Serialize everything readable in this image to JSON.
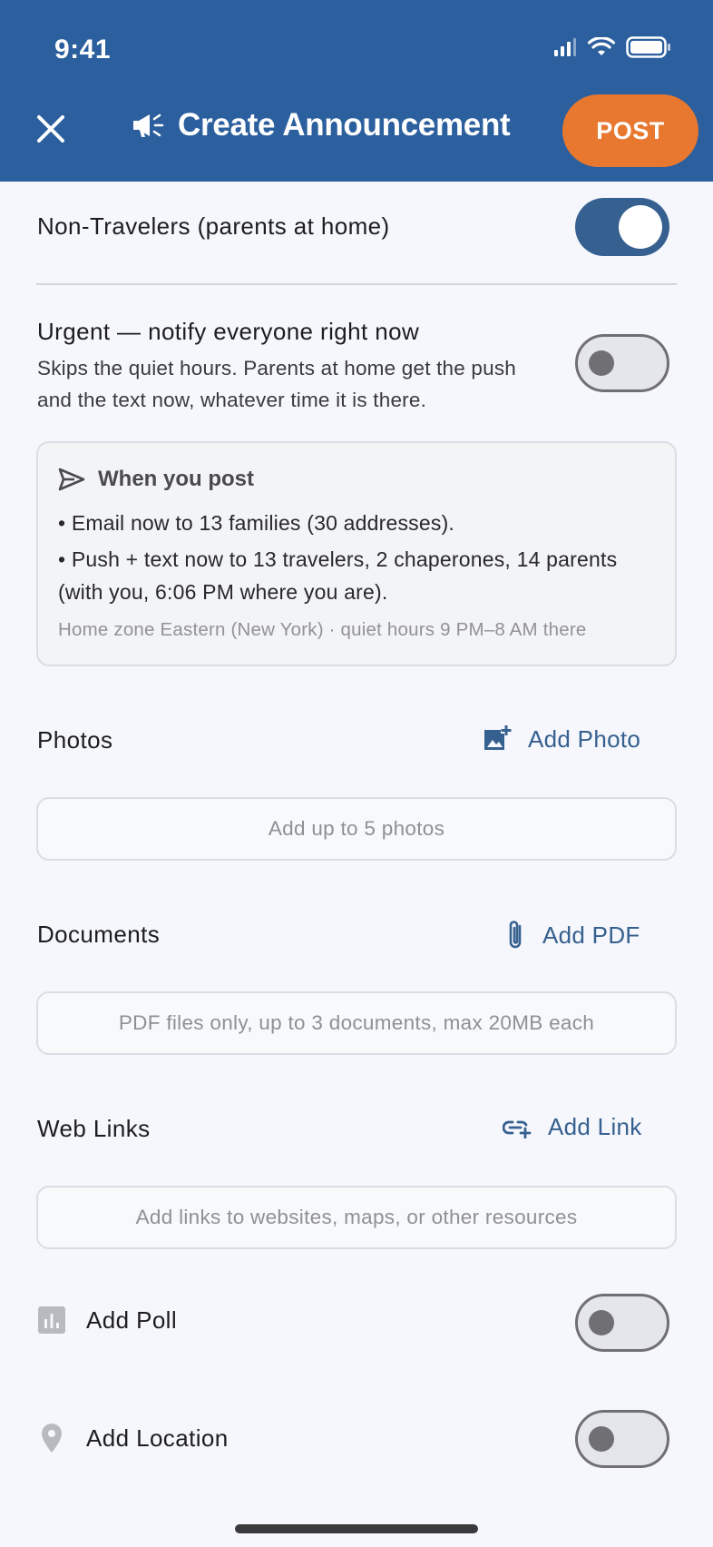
{
  "status_bar": {
    "time": "9:41"
  },
  "header": {
    "title": "Create Announcement",
    "post_label": "POST",
    "icons": {
      "close": "close-icon",
      "megaphone": "megaphone-icon"
    }
  },
  "audience": {
    "non_travelers_label": "Non-Travelers (parents at home)",
    "non_travelers_on": true
  },
  "urgent": {
    "title": "Urgent — notify everyone right now",
    "description": "Skips the quiet hours. Parents at home get the push and the text now, whatever time it is there.",
    "on": false
  },
  "info_card": {
    "title": "When you post",
    "lines": [
      "• Email now to 13 families (30 addresses).",
      "• Push + text now to 13 travelers, 2 chaperones, 14 parents (with you, 6:06 PM where you are)."
    ],
    "footer": "Home zone Eastern (New York) · quiet hours 9 PM–8 AM there"
  },
  "photos": {
    "label": "Photos",
    "action": "Add Photo",
    "placeholder": "Add up to 5 photos"
  },
  "documents": {
    "label": "Documents",
    "action": "Add PDF",
    "placeholder": "PDF files only, up to 3 documents, max 20MB each"
  },
  "links": {
    "label": "Web Links",
    "action": "Add Link",
    "placeholder": "Add links to websites, maps, or other resources"
  },
  "poll": {
    "label": "Add Poll",
    "on": false
  },
  "location": {
    "label": "Add Location",
    "on": false
  },
  "colors": {
    "header_bg": "#2c5f9e",
    "post_button": "#e8782f",
    "accent": "#36608f"
  }
}
